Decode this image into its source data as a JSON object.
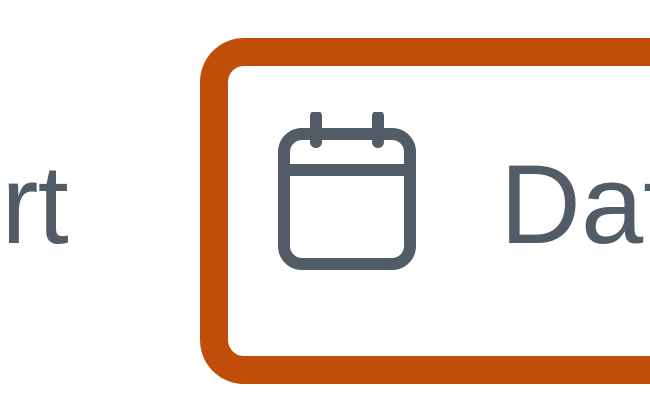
{
  "toolbar": {
    "prev_button_label": "ort",
    "date_button_label": "Dat",
    "date_button_icon": "calendar-icon"
  },
  "colors": {
    "focus_outline": "#c04d08",
    "text": "#525c67",
    "background": "#ffffff"
  }
}
